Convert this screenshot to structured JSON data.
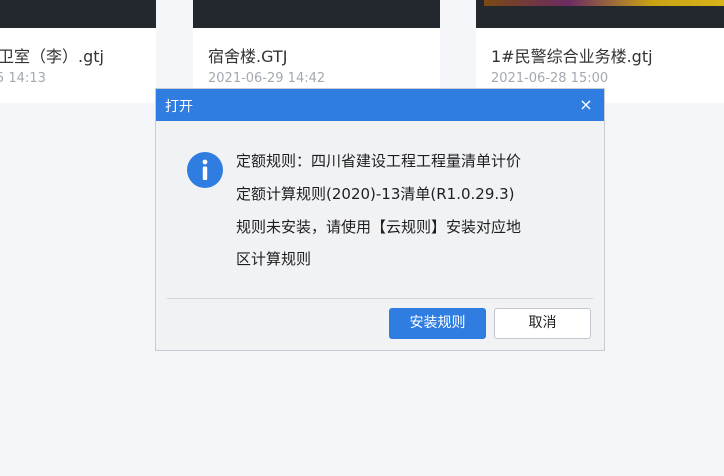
{
  "files": [
    {
      "name": "卫室（李）.gtj",
      "time": "5 14:13"
    },
    {
      "name": "宿舍楼.GTJ",
      "time": "2021-06-29 14:42"
    },
    {
      "name": "1#民警综合业务楼.gtj",
      "time": "2021-06-28 15:00"
    }
  ],
  "dialog": {
    "title": "打开",
    "close_glyph": "×",
    "message_lines": [
      "定额规则：四川省建设工程工程量清单计价",
      "定额计算规则(2020)-13清单(R1.0.29.3)",
      "规则未安装，请使用【云规则】安装对应地",
      "区计算规则"
    ],
    "install_label": "安装规则",
    "cancel_label": "取消",
    "icon": "info-icon"
  },
  "colors": {
    "accent": "#2f7de1",
    "background": "#f4f6f9",
    "thumb_dark": "#23282f"
  }
}
